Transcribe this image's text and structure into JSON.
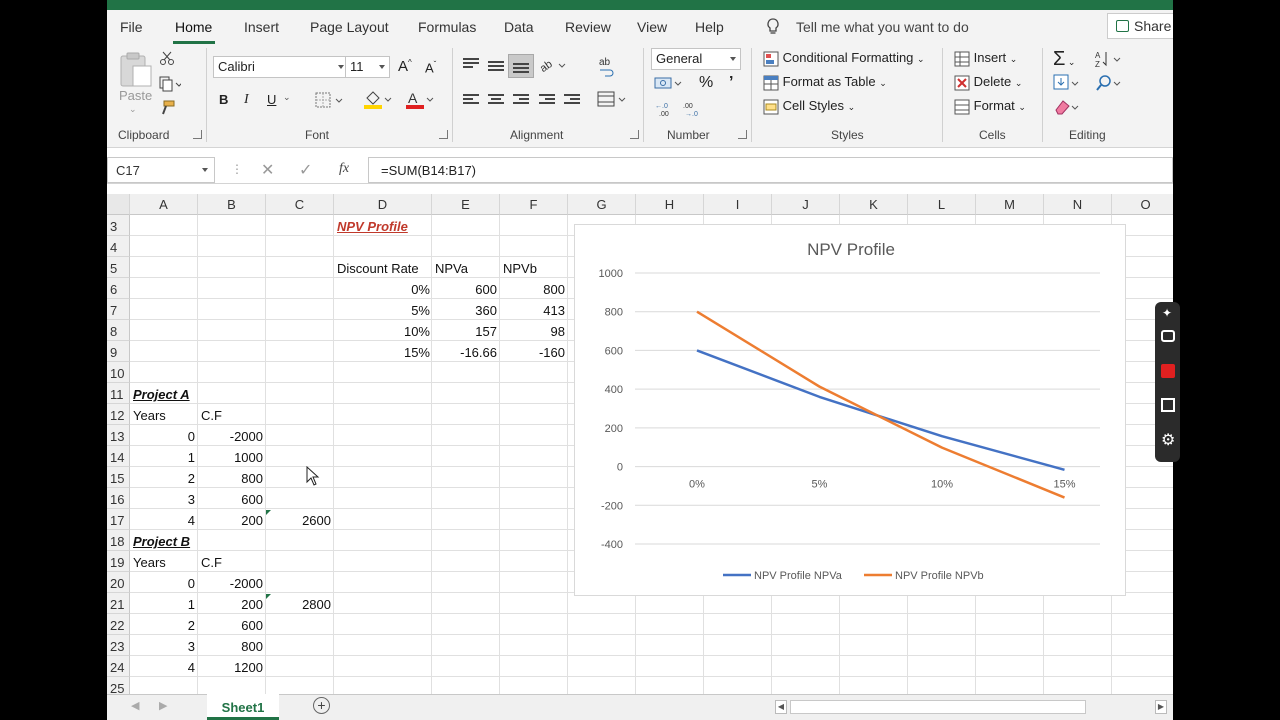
{
  "menu": {
    "items": [
      "File",
      "Home",
      "Insert",
      "Page Layout",
      "Formulas",
      "Data",
      "Review",
      "View",
      "Help"
    ],
    "active": "Home",
    "tell_me": "Tell me what you want to do",
    "share": "Share"
  },
  "ribbon": {
    "clipboard": {
      "paste": "Paste",
      "label": "Clipboard"
    },
    "font": {
      "name": "Calibri",
      "size": "11",
      "bold": "B",
      "italic": "I",
      "underline": "U",
      "label": "Font"
    },
    "alignment": {
      "label": "Alignment"
    },
    "number": {
      "format": "General",
      "percent": "%",
      "comma": "’",
      "label": "Number"
    },
    "styles": {
      "conditional": "Conditional Formatting",
      "table": "Format as Table",
      "cell_styles": "Cell Styles",
      "label": "Styles"
    },
    "cells": {
      "insert": "Insert",
      "delete": "Delete",
      "format": "Format",
      "label": "Cells"
    },
    "editing": {
      "label": "Editing"
    }
  },
  "formula_bar": {
    "name_box": "C17",
    "fx": "fx",
    "formula": "=SUM(B14:B17)"
  },
  "columns": [
    "A",
    "B",
    "C",
    "D",
    "E",
    "F",
    "G",
    "H",
    "I",
    "J",
    "K",
    "L",
    "M",
    "N",
    "O"
  ],
  "rows": [
    "3",
    "4",
    "5",
    "6",
    "7",
    "8",
    "9",
    "10",
    "11",
    "12",
    "13",
    "14",
    "15",
    "16",
    "17",
    "18",
    "19",
    "20",
    "21",
    "22",
    "23",
    "24",
    "25"
  ],
  "cells": {
    "d3": "NPV Profile",
    "d5": "Discount Rate",
    "e5": "NPVa",
    "f5": "NPVb",
    "d6": "0%",
    "e6": "600",
    "f6": "800",
    "d7": "5%",
    "e7": "360",
    "f7": "413",
    "d8": "10%",
    "e8": "157",
    "f8": "98",
    "d9": "15%",
    "e9": "-16.66",
    "f9": "-160",
    "a11": "Project A",
    "a12": "Years",
    "b12": "C.F",
    "a13": "0",
    "b13": "-2000",
    "a14": "1",
    "b14": "1000",
    "a15": "2",
    "b15": "800",
    "a16": "3",
    "b16": "600",
    "a17": "4",
    "b17": "200",
    "c17": "2600",
    "a18": "Project B",
    "a19": "Years",
    "b19": "C.F",
    "a20": "0",
    "b20": "-2000",
    "a21": "1",
    "b21": "200",
    "c21": "2800",
    "a22": "2",
    "b22": "600",
    "a23": "3",
    "b23": "800",
    "a24": "4",
    "b24": "1200"
  },
  "sheet_tab": "Sheet1",
  "chart_data": {
    "type": "line",
    "title": "NPV Profile",
    "categories": [
      "0%",
      "5%",
      "10%",
      "15%"
    ],
    "series": [
      {
        "name": "NPV Profile NPVa",
        "values": [
          600,
          360,
          157,
          -16.66
        ],
        "color": "#4472c4"
      },
      {
        "name": "NPV Profile NPVb",
        "values": [
          800,
          413,
          98,
          -160
        ],
        "color": "#ed7d31"
      }
    ],
    "yticks": [
      "1000",
      "800",
      "600",
      "400",
      "200",
      "0",
      "-200",
      "-400"
    ],
    "ylim": [
      -400,
      1000
    ],
    "grid": true,
    "legend": "bottom"
  },
  "colors": {
    "excel_green": "#217346"
  }
}
